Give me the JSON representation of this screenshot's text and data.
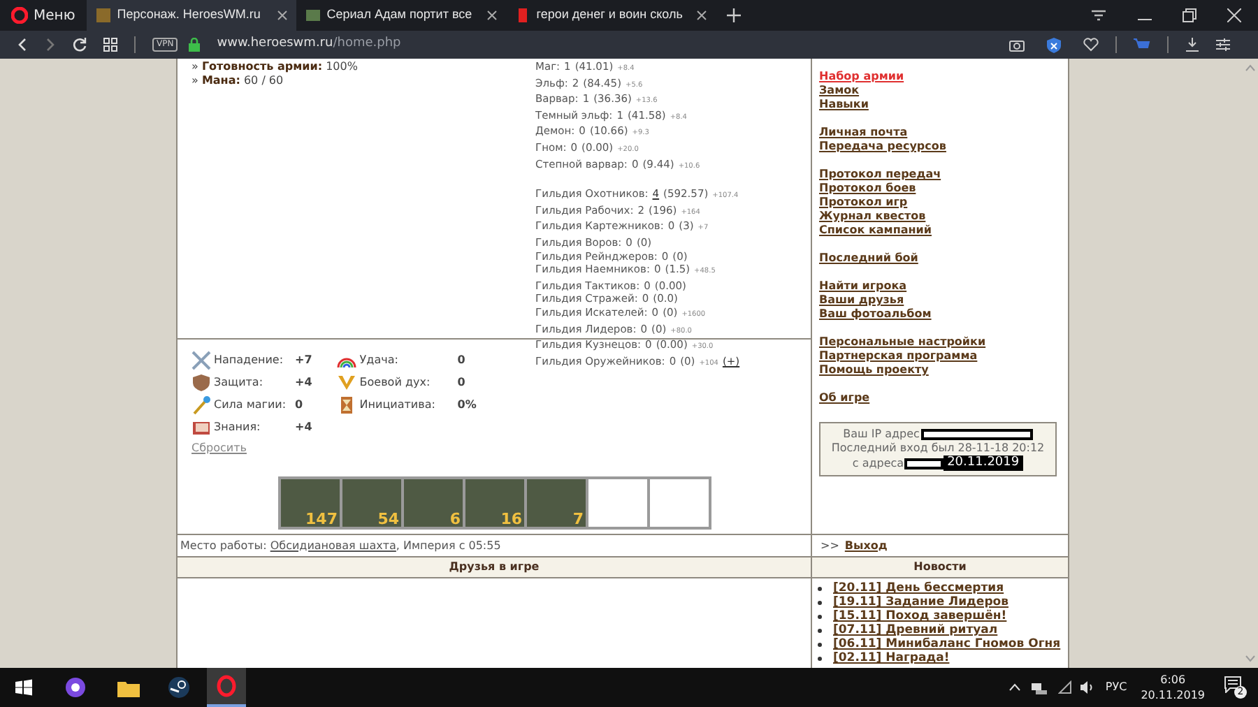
{
  "browser": {
    "menu_label": "Меню",
    "tabs": [
      {
        "title": "Персонаж. HeroesWM.ru",
        "selected": true
      },
      {
        "title": "Сериал Адам портит все",
        "selected": false
      },
      {
        "title": "герои денег и воин сколь",
        "selected": false
      }
    ],
    "vpn_label": "VPN",
    "url_host": "www.heroeswm.ru",
    "url_path": "/home.php"
  },
  "summary": [
    "» **Готовность армии:** 100%",
    "» **Мана:** 60 / 60"
  ],
  "factions": [
    {
      "name": "Маг:",
      "level": "1",
      "points": "(41.01)",
      "bonus": "+8.4",
      "level_link": false
    },
    {
      "name": "Эльф:",
      "level": "2",
      "points": "(84.45)",
      "bonus": "+5.6",
      "level_link": false
    },
    {
      "name": "Варвар:",
      "level": "1",
      "points": "(36.36)",
      "bonus": "+13.6",
      "level_link": false
    },
    {
      "name": "Темный эльф:",
      "level": "1",
      "points": "(41.58)",
      "bonus": "+8.4",
      "level_link": false
    },
    {
      "name": "Демон:",
      "level": "0",
      "points": "(10.66)",
      "bonus": "+9.3",
      "level_link": false
    },
    {
      "name": "Гном:",
      "level": "0",
      "points": "(0.00)",
      "bonus": "+20.0",
      "level_link": false
    },
    {
      "name": "Степной варвар:",
      "level": "0",
      "points": "(9.44)",
      "bonus": "+10.6",
      "level_link": false
    }
  ],
  "guilds": [
    {
      "name": "Гильдия Охотников:",
      "level": "4",
      "points": "(592.57)",
      "bonus": "+107.4",
      "level_link": true
    },
    {
      "name": "Гильдия Рабочих:",
      "level": "2",
      "points": "(196)",
      "bonus": "+164",
      "level_link": false
    },
    {
      "name": "Гильдия Картежников:",
      "level": "0",
      "points": "(3)",
      "bonus": "+7",
      "level_link": false
    },
    {
      "name": "Гильдия Воров:",
      "level": "0",
      "points": "(0)",
      "level_link": false
    },
    {
      "name": "Гильдия Рейнджеров:",
      "level": "0",
      "points": "(0)",
      "level_link": false
    },
    {
      "name": "Гильдия Наемников:",
      "level": "0",
      "points": "(1.5)",
      "bonus": "+48.5",
      "level_link": false
    },
    {
      "name": "Гильдия Тактиков:",
      "level": "0",
      "points": "(0.00)",
      "level_link": false
    },
    {
      "name": "Гильдия Стражей:",
      "level": "0",
      "points": "(0.0)",
      "level_link": false
    },
    {
      "name": "Гильдия Искателей:",
      "level": "0",
      "points": "(0)",
      "bonus": "+1600",
      "level_link": false
    },
    {
      "name": "Гильдия Лидеров:",
      "level": "0",
      "points": "(0)",
      "bonus": "+80.0",
      "level_link": false
    },
    {
      "name": "Гильдия Кузнецов:",
      "level": "0",
      "points": "(0.00)",
      "bonus": "+30.0",
      "level_link": false
    },
    {
      "name": "Гильдия Оружейников:",
      "level": "0",
      "points": "(0)",
      "bonus": "+104",
      "action": "(+)",
      "level_link": false
    }
  ],
  "attributes": [
    [
      {
        "kind": "attack",
        "label": "Нападение:",
        "value": "+7"
      },
      {
        "kind": "defense",
        "label": "Защита:",
        "value": "+4"
      },
      {
        "kind": "spellpower",
        "label": "Сила магии:",
        "value": "0"
      },
      {
        "kind": "knowledge",
        "label": "Знания:",
        "value": "+4"
      }
    ],
    [
      {
        "kind": "luck",
        "label": "Удача:",
        "value": "0"
      },
      {
        "kind": "morale",
        "label": "Боевой дух:",
        "value": "0"
      },
      {
        "kind": "initiative",
        "label": "Инициатива:",
        "value": "0%"
      }
    ]
  ],
  "reset_link": "Сбросить",
  "army": [
    {
      "kind": "unit",
      "count": "147"
    },
    {
      "kind": "unit",
      "count": "54"
    },
    {
      "kind": "unit",
      "count": "6"
    },
    {
      "kind": "unit",
      "count": "16"
    },
    {
      "kind": "unit",
      "count": "7"
    },
    {
      "kind": "empty"
    },
    {
      "kind": "empty"
    }
  ],
  "work": {
    "label": "Место работы:",
    "place": "Обсидиановая шахта",
    "rest": ", Империя с 05:55"
  },
  "menu_groups": [
    [
      {
        "label": "Набор армии",
        "selected": true
      },
      {
        "label": "Замок",
        "selected": false
      },
      {
        "label": "Навыки",
        "selected": false
      }
    ],
    [
      {
        "label": "Личная почта",
        "selected": false
      },
      {
        "label": "Передача ресурсов",
        "selected": false
      }
    ],
    [
      {
        "label": "Протокол передач",
        "selected": false
      },
      {
        "label": "Протокол боев",
        "selected": false
      },
      {
        "label": "Протокол игр",
        "selected": false
      },
      {
        "label": "Журнал квестов",
        "selected": false
      },
      {
        "label": "Список кампаний",
        "selected": false
      }
    ],
    [
      {
        "label": "Последний бой",
        "selected": false
      }
    ],
    [
      {
        "label": "Найти игрока",
        "selected": false
      },
      {
        "label": "Ваши друзья",
        "selected": false
      },
      {
        "label": "Ваш фотоальбом",
        "selected": false
      }
    ],
    [
      {
        "label": "Персональные настройки",
        "selected": false
      },
      {
        "label": "Партнерская программа",
        "selected": false
      },
      {
        "label": "Помощь проекту",
        "selected": false
      }
    ],
    [
      {
        "label": "Об игре",
        "selected": false
      }
    ]
  ],
  "ip_box": {
    "ip_label": "Ваш IP адрес",
    "last_login": "Последний вход был 28-11-18 20:12",
    "from_label": "с адреса",
    "date_stamp": "20.11.2019"
  },
  "logout": {
    "marker": ">>",
    "label": "Выход"
  },
  "friends_header": "Друзья в игре",
  "news_header": "Новости",
  "news": [
    "[20.11] День бессмертия",
    "[19.11] Задание Лидеров",
    "[15.11] Поход завершён!",
    "[07.11] Древний ритуал",
    "[06.11] Минибаланс Гномов Огня",
    "[02.11] Награда!"
  ],
  "taskbar": {
    "language": "РУС",
    "time": "6:06",
    "date": "20.11.2019",
    "notifications": "2"
  }
}
